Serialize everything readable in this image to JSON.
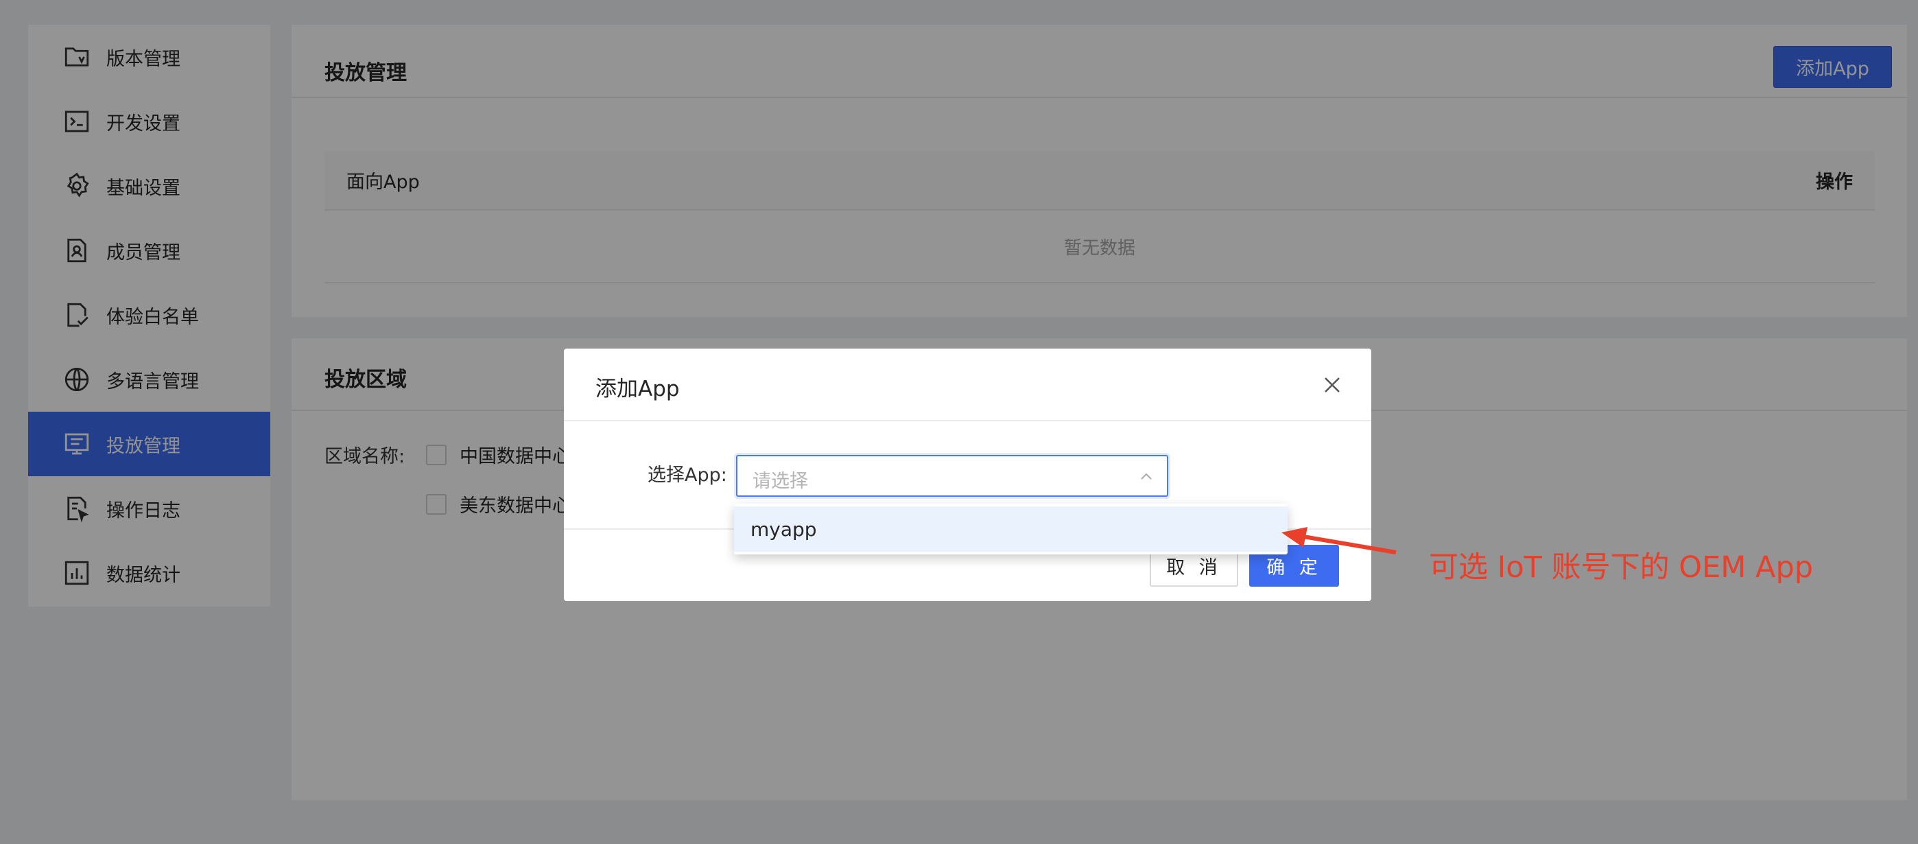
{
  "sidebar": {
    "items": [
      {
        "label": "版本管理",
        "icon": "folder-version-icon",
        "active": false
      },
      {
        "label": "开发设置",
        "icon": "terminal-icon",
        "active": false
      },
      {
        "label": "基础设置",
        "icon": "gear-icon",
        "active": false
      },
      {
        "label": "成员管理",
        "icon": "member-icon",
        "active": false
      },
      {
        "label": "体验白名单",
        "icon": "whitelist-icon",
        "active": false
      },
      {
        "label": "多语言管理",
        "icon": "globe-icon",
        "active": false
      },
      {
        "label": "投放管理",
        "icon": "monitor-icon",
        "active": true
      },
      {
        "label": "操作日志",
        "icon": "log-icon",
        "active": false
      },
      {
        "label": "数据统计",
        "icon": "chart-icon",
        "active": false
      }
    ]
  },
  "delivery_card": {
    "title": "投放管理",
    "add_button": "添加App",
    "table": {
      "columns": [
        "面向App",
        "操作"
      ],
      "empty_text": "暂无数据"
    }
  },
  "region_card": {
    "title": "投放区域",
    "label": "区域名称:",
    "options": [
      "中国数据中心",
      "美东数据中心"
    ]
  },
  "modal": {
    "title": "添加App",
    "field_label": "选择App:",
    "select_placeholder": "请选择",
    "dropdown_options": [
      "myapp"
    ],
    "cancel": "取 消",
    "ok": "确 定"
  },
  "annotation": "可选 IoT 账号下的 OEM App",
  "colors": {
    "primary": "#3d6cf0",
    "annotation": "#e8402a",
    "overlay": "rgba(0,0,0,0.42)"
  }
}
